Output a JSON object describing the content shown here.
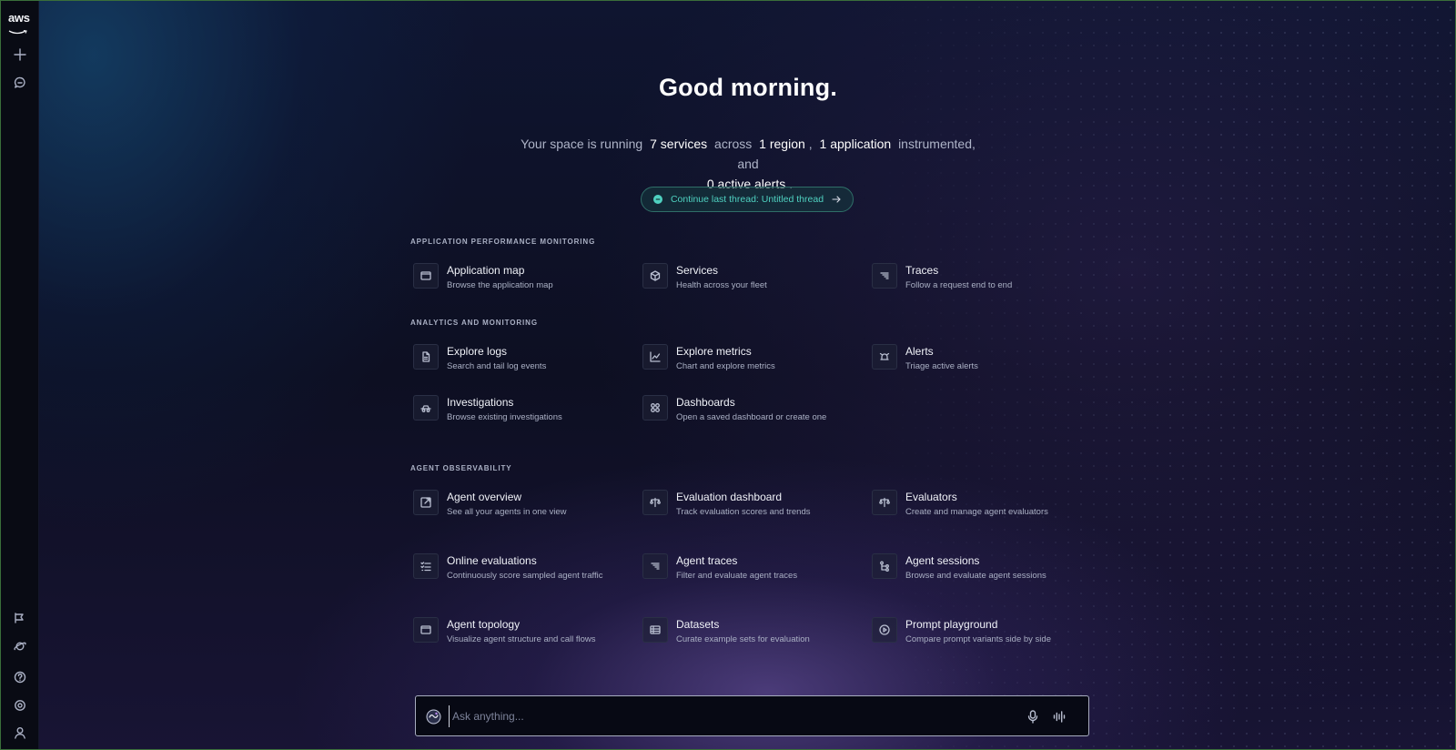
{
  "sidebar": {
    "logo_text": "aws",
    "top_icons": [
      "plus-icon",
      "chat-icon"
    ],
    "bottom_icons": [
      "announcement-icon",
      "planet-icon",
      "help-icon",
      "settings-icon",
      "user-icon"
    ]
  },
  "hero": {
    "greeting": "Good morning.",
    "summary_prefix": "Your space is running",
    "services": "7 services",
    "across": "across",
    "region": "1 region",
    "comma": ",",
    "application": "1 application",
    "instrumented": "instrumented, and",
    "alerts": "0 active alerts",
    "period": "."
  },
  "continue_thread": {
    "label": "Continue last thread: Untitled thread",
    "accent": "#4fd1c0"
  },
  "sections": {
    "apm": {
      "title": "APPLICATION PERFORMANCE MONITORING",
      "cards": [
        {
          "title": "Application map",
          "desc": "Browse the application map",
          "icon": "map-icon"
        },
        {
          "title": "Services",
          "desc": "Health across your fleet",
          "icon": "cube-icon"
        },
        {
          "title": "Traces",
          "desc": "Follow a request end to end",
          "icon": "traces-icon"
        }
      ]
    },
    "analytics": {
      "title": "ANALYTICS AND MONITORING",
      "cards": [
        {
          "title": "Explore logs",
          "desc": "Search and tail log events",
          "icon": "log-file-icon"
        },
        {
          "title": "Explore metrics",
          "desc": "Chart and explore metrics",
          "icon": "line-chart-icon"
        },
        {
          "title": "Alerts",
          "desc": "Triage active alerts",
          "icon": "alarm-icon"
        },
        {
          "title": "Investigations",
          "desc": "Browse existing investigations",
          "icon": "investigation-icon"
        },
        {
          "title": "Dashboards",
          "desc": "Open a saved dashboard or create one",
          "icon": "dashboard-grid-icon"
        }
      ]
    },
    "agent": {
      "title": "AGENT OBSERVABILITY",
      "cards": [
        {
          "title": "Agent overview",
          "desc": "See all your agents in one view",
          "icon": "overview-icon"
        },
        {
          "title": "Evaluation dashboard",
          "desc": "Track evaluation scores and trends",
          "icon": "scale-icon"
        },
        {
          "title": "Evaluators",
          "desc": "Create and manage agent evaluators",
          "icon": "scale-icon"
        },
        {
          "title": "Online evaluations",
          "desc": "Continuously score sampled agent traffic",
          "icon": "checklist-icon"
        },
        {
          "title": "Agent traces",
          "desc": "Filter and evaluate agent traces",
          "icon": "traces-icon"
        },
        {
          "title": "Agent sessions",
          "desc": "Browse and evaluate agent sessions",
          "icon": "sessions-icon"
        },
        {
          "title": "Agent topology",
          "desc": "Visualize agent structure and call flows",
          "icon": "topology-icon"
        },
        {
          "title": "Datasets",
          "desc": "Curate example sets for evaluation",
          "icon": "table-icon"
        },
        {
          "title": "Prompt playground",
          "desc": "Compare prompt variants side by side",
          "icon": "play-circle-icon"
        }
      ]
    }
  },
  "ask": {
    "placeholder": "Ask anything..."
  }
}
